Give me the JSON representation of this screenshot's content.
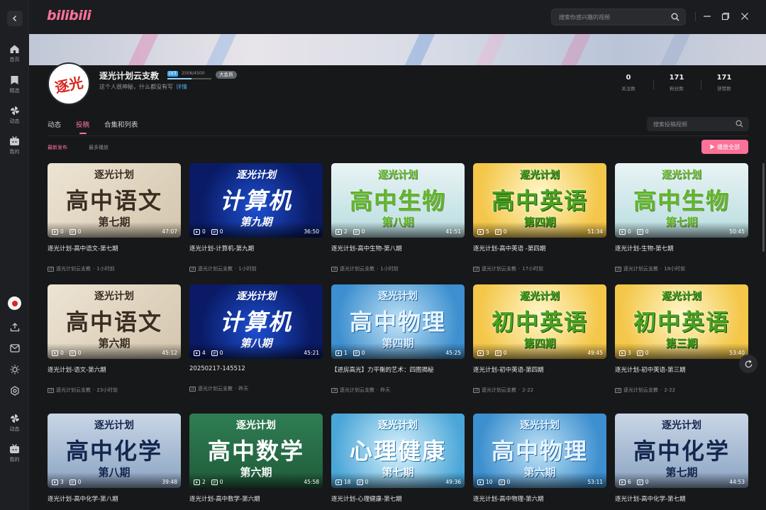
{
  "app": {
    "logo": "bilibili"
  },
  "sidebar": {
    "items": [
      {
        "label": "首页",
        "icon": "home-icon"
      },
      {
        "label": "精选",
        "icon": "bookmark-icon"
      },
      {
        "label": "动态",
        "icon": "pinwheel-icon"
      },
      {
        "label": "我的",
        "icon": "tv-icon"
      }
    ],
    "bottom_items": [
      {
        "label": "动态",
        "icon": "pinwheel-icon"
      },
      {
        "label": "我的",
        "icon": "tv-icon"
      }
    ]
  },
  "topbar": {
    "search_placeholder": "搜索你感兴趣的视频"
  },
  "profile": {
    "name": "逐光计划云支教",
    "avatar_text": "逐光",
    "level": "LV3",
    "level_progress": "2506/4500",
    "vip_badge": "大会员",
    "bio": "这个人很神秘，什么都没有写",
    "bio_link": "详情",
    "stats": [
      {
        "value": "0",
        "label": "关注数"
      },
      {
        "value": "171",
        "label": "粉丝数"
      },
      {
        "value": "171",
        "label": "获赞数"
      }
    ]
  },
  "tabs": [
    {
      "label": "动态",
      "active": false
    },
    {
      "label": "投稿",
      "active": true
    },
    {
      "label": "合集和列表",
      "active": false
    }
  ],
  "video_search_placeholder": "搜索投稿视频",
  "sort": {
    "latest": "最新发布",
    "most_played": "最多播放"
  },
  "play_all": "播放全部",
  "videos": [
    {
      "theme": "chinese",
      "t1": "逐光计划",
      "t2": "高中语文",
      "t3": "第七期",
      "plays": "0",
      "danmaku": "0",
      "duration": "47:07",
      "title": "逐光计划-高中语文-第七期",
      "uploader": "逐光计划云支教",
      "time": "1小时前"
    },
    {
      "theme": "computer",
      "t1": "逐光计划",
      "t2": "计算机",
      "t3": "第九期",
      "plays": "0",
      "danmaku": "0",
      "duration": "36:50",
      "title": "逐光计划-计算机-第九期",
      "uploader": "逐光计划云支教",
      "time": "1小时前"
    },
    {
      "theme": "bio",
      "t1": "逐光计划",
      "t2": "高中生物",
      "t3": "第八期",
      "plays": "2",
      "danmaku": "0",
      "duration": "41:51",
      "title": "逐光计划-高中生物-第八期",
      "uploader": "逐光计划云支教",
      "time": "1小时前"
    },
    {
      "theme": "eng",
      "t1": "逐光计划",
      "t2": "高中英语",
      "t3": "第四期",
      "plays": "5",
      "danmaku": "0",
      "duration": "51:34",
      "title": "逐光计划-高中英语 -第四期",
      "uploader": "逐光计划云支教",
      "time": "17小时前"
    },
    {
      "theme": "bio",
      "t1": "逐光计划",
      "t2": "高中生物",
      "t3": "第七期",
      "plays": "0",
      "danmaku": "0",
      "duration": "50:45",
      "title": "逐光计划-生物-第七期",
      "uploader": "逐光计划云支教",
      "time": "18小时前"
    },
    {
      "theme": "chinese",
      "t1": "逐光计划",
      "t2": "高中语文",
      "t3": "第六期",
      "plays": "0",
      "danmaku": "0",
      "duration": "45:12",
      "title": "逐光计划-语文-第六期",
      "uploader": "逐光计划云支教",
      "time": "23小时前"
    },
    {
      "theme": "computer",
      "t1": "逐光计划",
      "t2": "计算机",
      "t3": "第八期",
      "plays": "4",
      "danmaku": "0",
      "duration": "45:21",
      "title": "20250217-145512",
      "uploader": "逐光计划云支教",
      "time": "昨天"
    },
    {
      "theme": "phy",
      "t1": "逐光计划",
      "t2": "高中物理",
      "t3": "第四期",
      "plays": "1",
      "danmaku": "0",
      "duration": "45:25",
      "title": "【进房高光】力平衡的艺术：四图揭秘",
      "uploader": "逐光计划云支教",
      "time": "昨天"
    },
    {
      "theme": "eng",
      "t1": "逐光计划",
      "t2": "初中英语",
      "t3": "第四期",
      "plays": "3",
      "danmaku": "0",
      "duration": "49:45",
      "title": "逐光计划-初中英语-第四期",
      "uploader": "逐光计划云支教",
      "time": "2-22"
    },
    {
      "theme": "eng",
      "t1": "逐光计划",
      "t2": "初中英语",
      "t3": "第三期",
      "plays": "3",
      "danmaku": "0",
      "duration": "53:40",
      "title": "逐光计划-初中英语-第三期",
      "uploader": "逐光计划云支教",
      "time": "2-22"
    },
    {
      "theme": "chem",
      "t1": "逐光计划",
      "t2": "高中化学",
      "t3": "第八期",
      "plays": "3",
      "danmaku": "0",
      "duration": "39:48",
      "title": "逐光计划-高中化学-第八期",
      "uploader": "",
      "time": ""
    },
    {
      "theme": "math",
      "t1": "逐光计划",
      "t2": "高中数学",
      "t3": "第六期",
      "plays": "2",
      "danmaku": "0",
      "duration": "45:58",
      "title": "逐光计划-高中数学-第六期",
      "uploader": "",
      "time": ""
    },
    {
      "theme": "psy",
      "t1": "逐光计划",
      "t2": "心理健康",
      "t3": "第七期",
      "plays": "18",
      "danmaku": "0",
      "duration": "49:36",
      "title": "逐光计划-心理健康-第七期",
      "uploader": "",
      "time": ""
    },
    {
      "theme": "phy",
      "t1": "逐光计划",
      "t2": "高中物理",
      "t3": "第六期",
      "plays": "10",
      "danmaku": "0",
      "duration": "53:11",
      "title": "逐光计划-高中物理-第六期",
      "uploader": "",
      "time": ""
    },
    {
      "theme": "chem",
      "t1": "逐光计划",
      "t2": "高中化学",
      "t3": "第七期",
      "plays": "6",
      "danmaku": "0",
      "duration": "44:53",
      "title": "逐光计划-高中化学-第七期",
      "uploader": "",
      "time": ""
    }
  ],
  "colors": {
    "accent": "#fb7299",
    "background": "#17181a",
    "link": "#4aa8e6"
  }
}
